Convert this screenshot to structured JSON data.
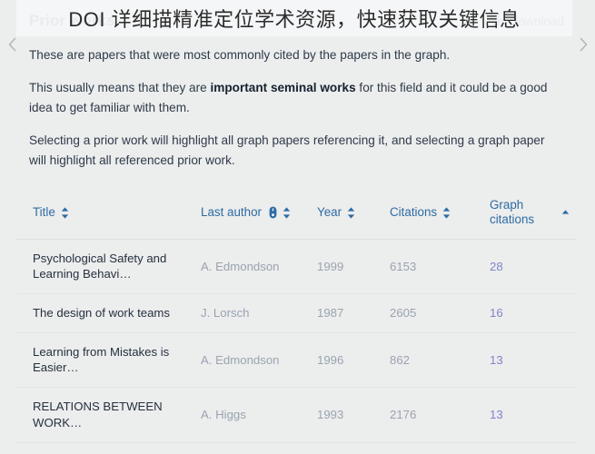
{
  "overlay": {
    "text": "DOI 详细描精准定位学术资源，快速获取关键信息"
  },
  "nav": {
    "prev_icon": "chevron-left-icon",
    "next_icon": "chevron-right-icon"
  },
  "panel": {
    "title": "Prior works",
    "download_label": "Download",
    "download_icon": "download-icon",
    "paragraphs": [
      {
        "segments": [
          {
            "text": "These are papers that were most commonly cited by the papers in the graph.",
            "bold": false
          }
        ]
      },
      {
        "segments": [
          {
            "text": "This usually means that they are ",
            "bold": false
          },
          {
            "text": "important seminal works",
            "bold": true
          },
          {
            "text": " for this field and it could be a good idea to get familiar with them.",
            "bold": false
          }
        ]
      },
      {
        "segments": [
          {
            "text": "Selecting a prior work will highlight all graph papers referencing it, and selecting a graph paper will highlight all referenced prior work.",
            "bold": false
          }
        ]
      }
    ]
  },
  "table": {
    "columns": [
      {
        "key": "title",
        "label": "Title",
        "sort_icon": "sort-both-icon",
        "extra_icon": null,
        "sorted": "none"
      },
      {
        "key": "author",
        "label": "Last author",
        "sort_icon": "sort-both-icon",
        "extra_icon": "mouse-icon",
        "sorted": "none"
      },
      {
        "key": "year",
        "label": "Year",
        "sort_icon": "sort-both-icon",
        "extra_icon": null,
        "sorted": "none"
      },
      {
        "key": "cit",
        "label": "Citations",
        "sort_icon": "sort-both-icon",
        "extra_icon": null,
        "sorted": "none"
      },
      {
        "key": "graphcit",
        "label": "Graph citations",
        "sort_icon": "sort-asc-icon",
        "extra_icon": null,
        "sorted": "asc"
      }
    ],
    "rows": [
      {
        "title": "Psychological Safety and Learning Behavi…",
        "author": "A. Edmondson",
        "year": "1999",
        "citations": "6153",
        "graph_citations": "28"
      },
      {
        "title": "The design of work teams",
        "author": "J. Lorsch",
        "year": "1987",
        "citations": "2605",
        "graph_citations": "16"
      },
      {
        "title": "Learning from Mistakes is Easier…",
        "author": "A. Edmondson",
        "year": "1996",
        "citations": "862",
        "graph_citations": "13"
      },
      {
        "title": "RELATIONS BETWEEN WORK…",
        "author": "A. Higgs",
        "year": "1993",
        "citations": "2176",
        "graph_citations": "13"
      }
    ]
  },
  "colors": {
    "page_bg": "#eceded",
    "header_link": "#2e6ca4",
    "graph_citation_value": "#7e86c9",
    "muted_text": "#9aa4b0",
    "title_text": "#26313f"
  }
}
